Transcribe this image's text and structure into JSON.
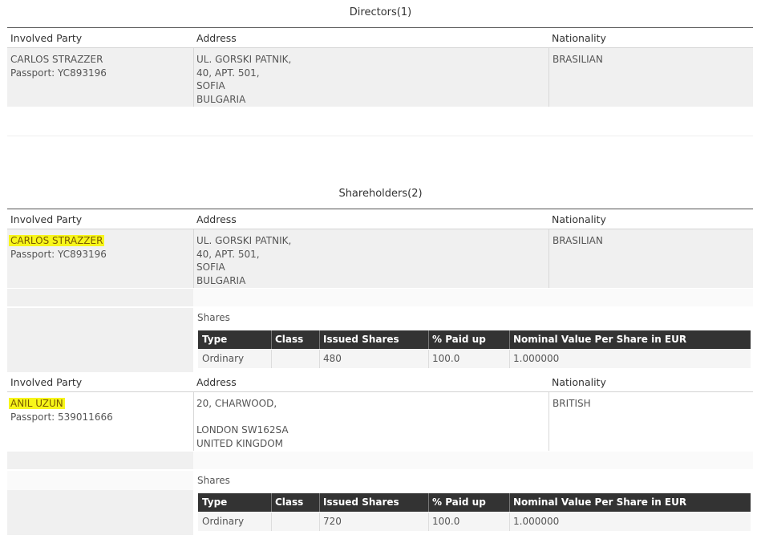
{
  "directors": {
    "title": "Directors(1)",
    "headers": {
      "party": "Involved Party",
      "address": "Address",
      "nationality": "Nationality"
    },
    "rows": [
      {
        "name": "CARLOS STRAZZER",
        "passport": "Passport: YC893196",
        "address": [
          "UL. GORSKI PATNIK,",
          "40, APT. 501,",
          "SOFIA",
          "BULGARIA"
        ],
        "nationality": "BRASILIAN"
      }
    ]
  },
  "shareholders": {
    "title": "Shareholders(2)",
    "headers": {
      "party": "Involved Party",
      "address": "Address",
      "nationality": "Nationality"
    },
    "shares_label": "Shares",
    "shares_headers": [
      "Type",
      "Class",
      "Issued Shares",
      "% Paid up",
      "Nominal Value Per Share in EUR"
    ],
    "rows": [
      {
        "name": "CARLOS STRAZZER",
        "passport": "Passport: YC893196",
        "address": [
          "UL. GORSKI PATNIK,",
          "40, APT. 501,",
          "SOFIA",
          "BULGARIA"
        ],
        "nationality": "BRASILIAN",
        "shares": {
          "type": "Ordinary",
          "class": "",
          "issued": "480",
          "paid": "100.0",
          "nominal": "1.000000"
        }
      },
      {
        "name": "ANIL UZUN",
        "passport": "Passport: 539011666",
        "address": [
          "20, CHARWOOD,",
          "",
          "LONDON SW162SA",
          "UNITED KINGDOM"
        ],
        "nationality": "BRITISH",
        "shares": {
          "type": "Ordinary",
          "class": "",
          "issued": "720",
          "paid": "100.0",
          "nominal": "1.000000"
        }
      }
    ]
  },
  "colors": {
    "highlight": "#f7f61a",
    "table_header_bg": "#333333",
    "row_bg": "#f0f0f0"
  }
}
